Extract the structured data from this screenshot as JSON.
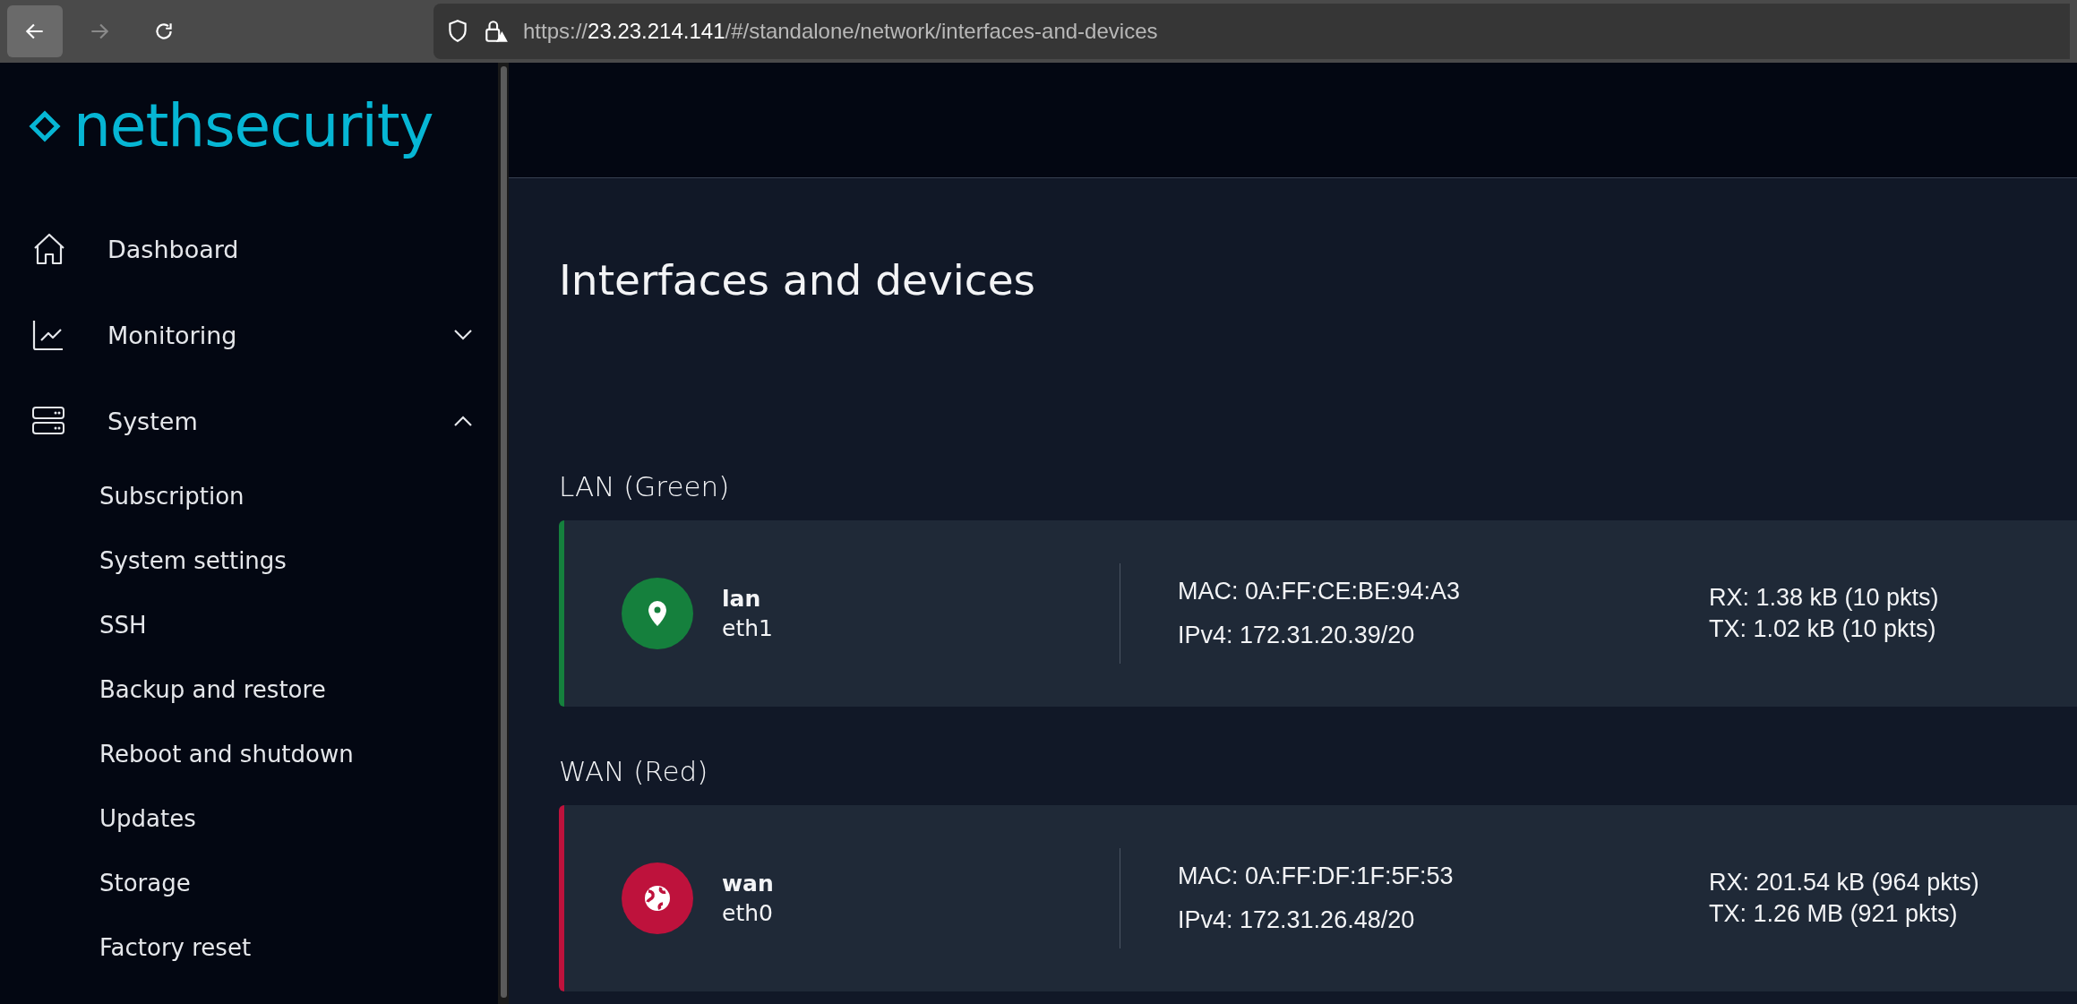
{
  "browser": {
    "url_path": "/#/standalone/network/interfaces-and-devices",
    "url_scheme_prefix": "https://",
    "host_only": "23.23.214.141"
  },
  "sidebar": {
    "logo": "nethsecurity",
    "items": [
      {
        "label": "Dashboard",
        "kind": "home"
      },
      {
        "label": "Monitoring",
        "kind": "chart",
        "expanded": false
      },
      {
        "label": "System",
        "kind": "server",
        "expanded": true,
        "children": [
          {
            "label": "Subscription"
          },
          {
            "label": "System settings"
          },
          {
            "label": "SSH"
          },
          {
            "label": "Backup and restore"
          },
          {
            "label": "Reboot and shutdown"
          },
          {
            "label": "Updates"
          },
          {
            "label": "Storage"
          },
          {
            "label": "Factory reset"
          }
        ]
      }
    ]
  },
  "page": {
    "title": "Interfaces and devices",
    "zones": [
      {
        "label": "LAN (Green)",
        "color": "#15803d",
        "kind": "lan",
        "interfaces": [
          {
            "name": "lan",
            "device": "eth1",
            "mac": "MAC: 0A:FF:CE:BE:94:A3",
            "ipv4": "IPv4: 172.31.20.39/20",
            "rx": "RX: 1.38 kB (10 pkts)",
            "tx": "TX: 1.02 kB (10 pkts)"
          }
        ]
      },
      {
        "label": "WAN (Red)",
        "color": "#be123c",
        "kind": "wan",
        "interfaces": [
          {
            "name": "wan",
            "device": "eth0",
            "mac": "MAC: 0A:FF:DF:1F:5F:53",
            "ipv4": "IPv4: 172.31.26.48/20",
            "rx": "RX: 201.54 kB (964 pkts)",
            "tx": "TX: 1.26 MB (921 pkts)"
          }
        ]
      }
    ]
  }
}
